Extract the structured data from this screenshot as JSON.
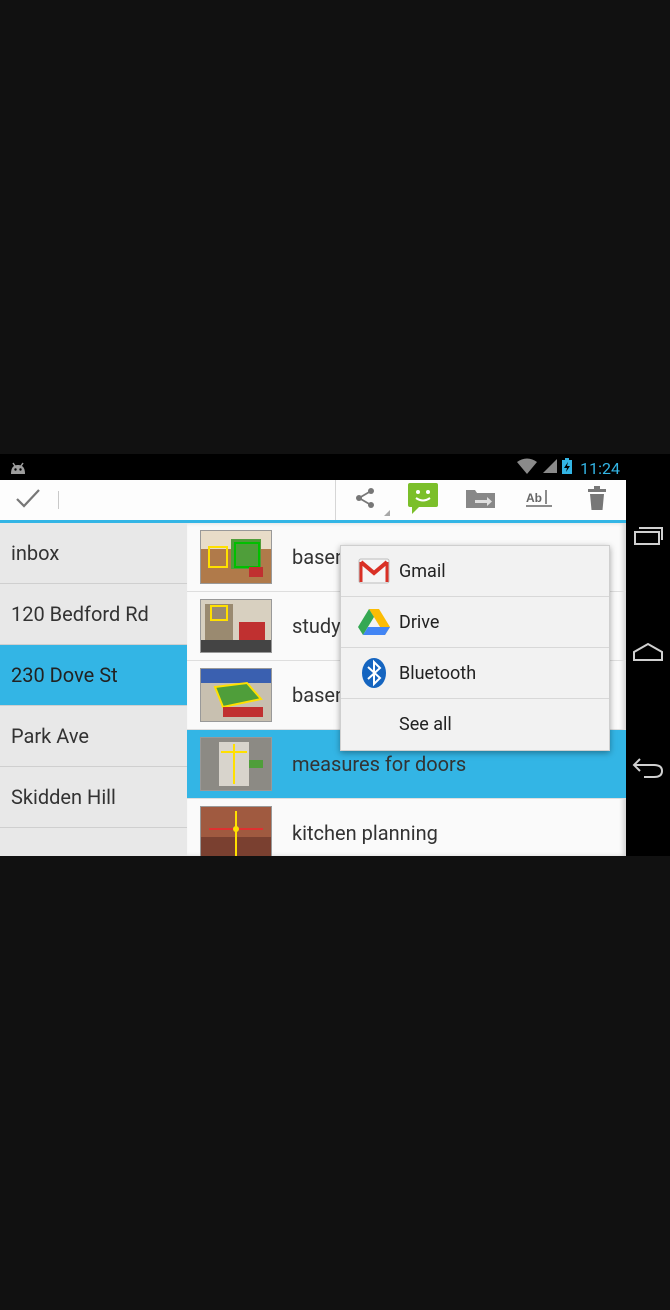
{
  "status_bar": {
    "time": "11:24",
    "icons": [
      "android-debug-icon",
      "wifi-icon",
      "signal-icon",
      "battery-charging-icon"
    ]
  },
  "action_bar": {
    "done_icon": "checkmark-icon",
    "actions": [
      "share-icon",
      "message-icon",
      "move-folder-icon",
      "rename-icon",
      "trash-icon"
    ]
  },
  "categories": [
    {
      "label": "inbox",
      "selected": false
    },
    {
      "label": "120 Bedford Rd",
      "selected": false
    },
    {
      "label": "230 Dove St",
      "selected": true
    },
    {
      "label": "Park Ave",
      "selected": false
    },
    {
      "label": "Skidden Hill",
      "selected": false
    }
  ],
  "notes": [
    {
      "title": "basement",
      "selected": false
    },
    {
      "title": "study",
      "selected": false
    },
    {
      "title": "basement markings",
      "selected": false
    },
    {
      "title": "measures for doors",
      "selected": true
    },
    {
      "title": "kitchen planning",
      "selected": false
    }
  ],
  "share_menu": {
    "items": [
      {
        "label": "Gmail",
        "icon": "gmail-icon"
      },
      {
        "label": "Drive",
        "icon": "drive-icon"
      },
      {
        "label": "Bluetooth",
        "icon": "bluetooth-icon"
      },
      {
        "label": "See all",
        "icon": ""
      }
    ]
  },
  "nav_bar": [
    "recents-icon",
    "home-icon",
    "back-icon"
  ],
  "colors": {
    "accent": "#33b5e5",
    "background": "#111111"
  }
}
